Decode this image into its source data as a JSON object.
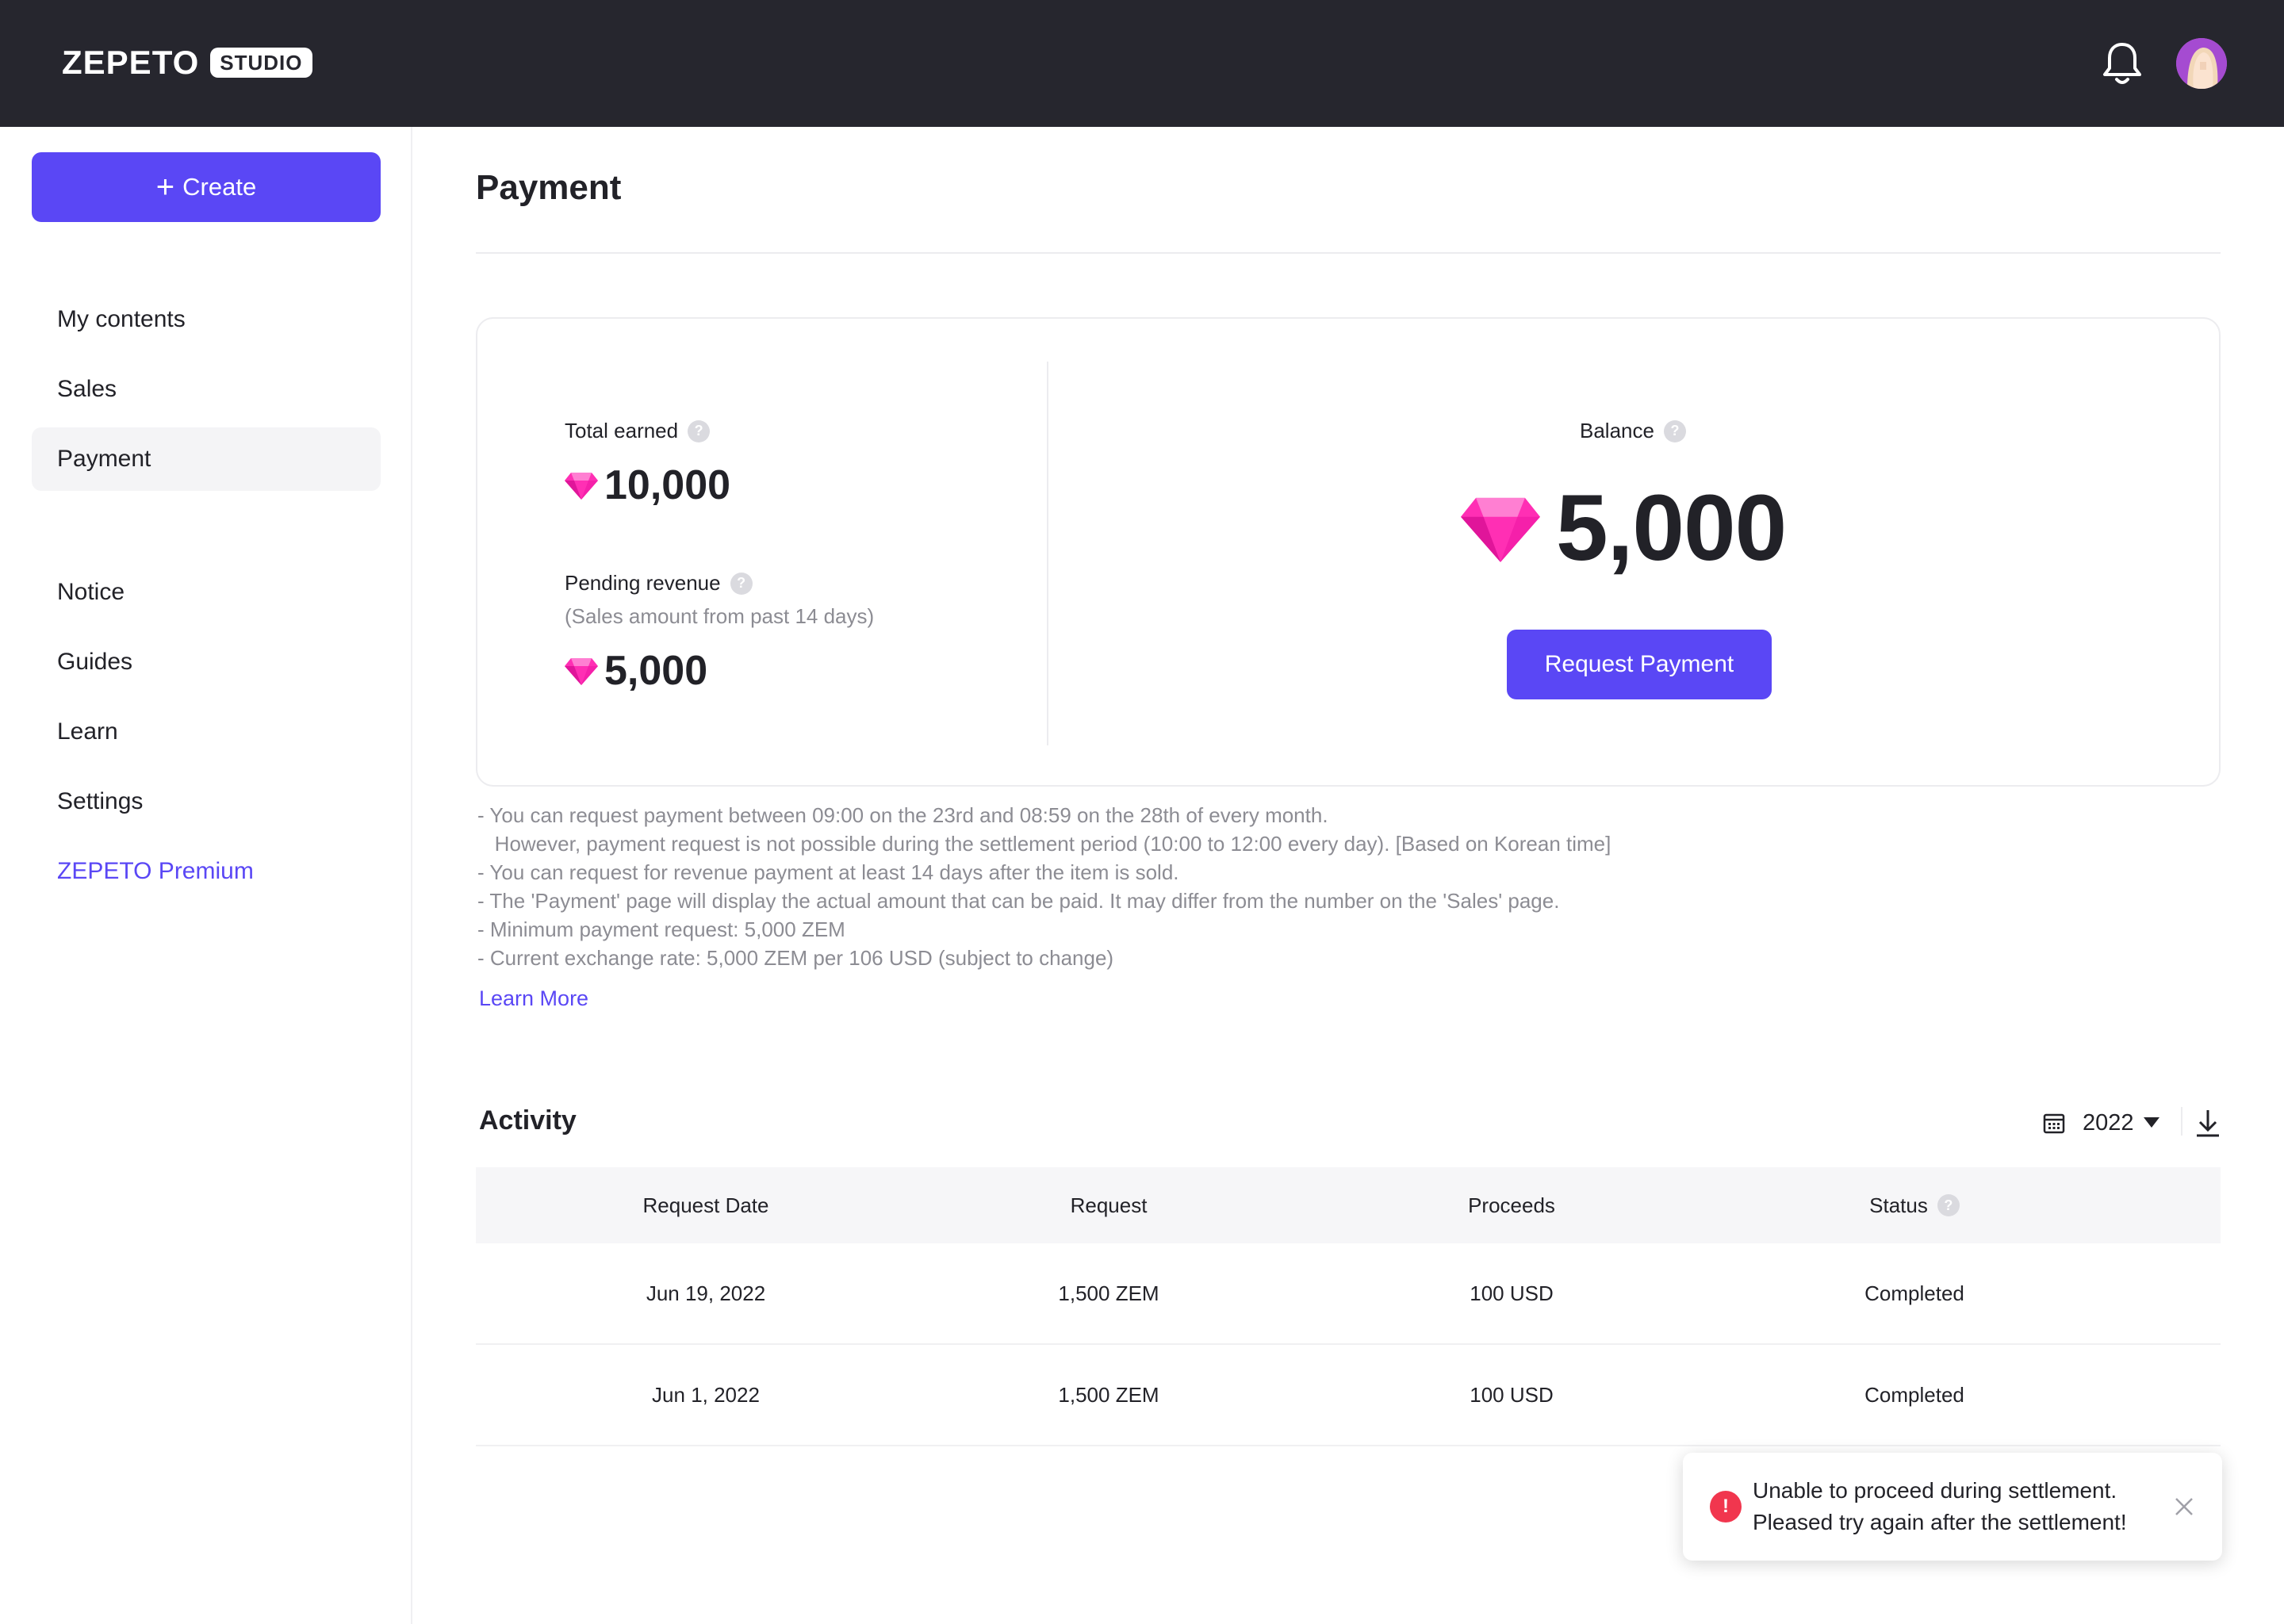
{
  "header": {
    "logo_text": "ZEPETO",
    "logo_badge": "STUDIO",
    "notification_icon": "bell-icon",
    "avatar_icon": "user-avatar"
  },
  "sidebar": {
    "create_label": "Create",
    "items": [
      {
        "label": "My contents"
      },
      {
        "label": "Sales"
      },
      {
        "label": "Payment",
        "active": true
      },
      {
        "label": "Notice"
      },
      {
        "label": "Guides"
      },
      {
        "label": "Learn"
      },
      {
        "label": "Settings"
      },
      {
        "label": "ZEPETO Premium"
      }
    ]
  },
  "page": {
    "title": "Payment"
  },
  "summary": {
    "total_earned_label": "Total earned",
    "total_earned_value": "10,000",
    "pending_label": "Pending revenue",
    "pending_sub": "(Sales amount from past 14 days)",
    "pending_value": "5,000",
    "balance_label": "Balance",
    "balance_value": "5,000",
    "request_button": "Request Payment",
    "help_glyph": "?"
  },
  "notes": [
    "- You can request payment between 09:00 on the 23rd and 08:59 on the 28th of every month.",
    "   However, payment request is not possible during the settlement period (10:00 to 12:00 every day). [Based on Korean time]",
    "- You can request for revenue payment at least 14 days after the item is sold.",
    "- The 'Payment' page will display the actual amount that can be paid. It may differ from the number on the 'Sales' page.",
    "- Minimum payment request: 5,000 ZEM",
    "- Current exchange rate: 5,000 ZEM per 106 USD (subject to change)"
  ],
  "learn_more": "Learn More",
  "activity": {
    "title": "Activity",
    "year": "2022",
    "columns": [
      "Request Date",
      "Request",
      "Proceeds",
      "Status"
    ],
    "rows": [
      [
        "Jun 19, 2022",
        "1,500 ZEM",
        "100 USD",
        "Completed"
      ],
      [
        "Jun 1, 2022",
        "1,500 ZEM",
        "100 USD",
        "Completed"
      ]
    ]
  },
  "toast": {
    "line1": "Unable to proceed during settlement.",
    "line2": "Pleased try again after the settlement!",
    "icon_glyph": "!"
  },
  "colors": {
    "accent": "#5a47f5",
    "header_bg": "#26262e",
    "gem": "#ff2fb4",
    "error": "#f1364e"
  }
}
